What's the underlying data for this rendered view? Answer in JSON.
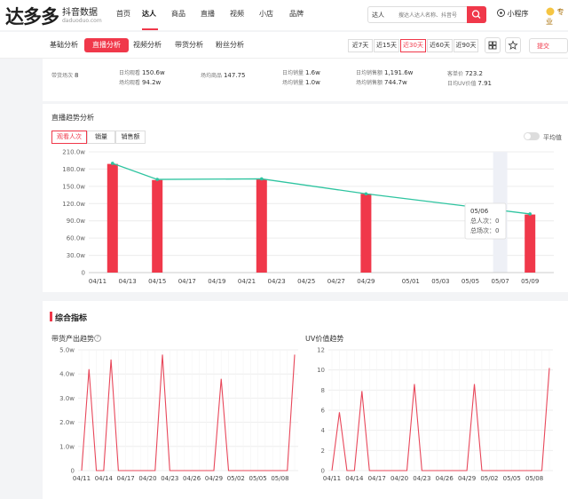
{
  "logo": {
    "name": "达多多",
    "sub": "抖音数据",
    "url": "daduoduo.com"
  },
  "nav": [
    "首页",
    "达人",
    "商品",
    "直播",
    "视频",
    "小店",
    "品牌"
  ],
  "search": {
    "type": "达人",
    "placeholder": "搜达人达人名称、抖音号"
  },
  "mini_program": "小程序",
  "pro": "专业",
  "tabs": [
    "基础分析",
    "直播分析",
    "视频分析",
    "带货分析",
    "粉丝分析"
  ],
  "active_tab": "直播分析",
  "ranges": [
    "近7天",
    "近15天",
    "近30天",
    "近60天",
    "近90天"
  ],
  "selected_range": "近30天",
  "sample": "提交",
  "stats": {
    "c1_label": "带货场次",
    "c1_value": "8",
    "c2_l1": "日均观看",
    "c2_v1": "150.6w",
    "c2_l2": "场均观看",
    "c2_v2": "94.2w",
    "c3_l1": "场均商品",
    "c3_v1": "147.75",
    "c4_l1": "日均销量",
    "c4_v1": "1.6w",
    "c4_l2": "场均销量",
    "c4_v2": "1.0w",
    "c5_l1": "日均销售额",
    "c5_v1": "1,191.6w",
    "c5_l2": "场均销售额",
    "c5_v2": "744.7w",
    "c6_l1": "客单价",
    "c6_v1": "723.2",
    "c6_l2": "日均UV价值",
    "c6_v2": "7.91"
  },
  "trend": {
    "title": "直播趋势分析",
    "segments": [
      "观看人次",
      "销量",
      "销售额"
    ],
    "toggle_label": "平均值",
    "tooltip": {
      "date": "05/06",
      "l1": "总人次",
      "v1": "0",
      "l2": "总场次",
      "v2": "0"
    }
  },
  "composite": {
    "title": "综合指标",
    "left_title": "带货产出趋势",
    "right_title": "UV价值趋势"
  },
  "colors": {
    "accent": "#f0384a",
    "line": "#2ec4a0"
  },
  "chart_data": [
    {
      "type": "bar",
      "ylim": [
        0,
        2100000
      ],
      "yticks": [
        "0",
        "30.0w",
        "60.0w",
        "90.0w",
        "120.0w",
        "150.0w",
        "180.0w",
        "210.0w"
      ],
      "xticks": [
        "04/11",
        "04/13",
        "04/15",
        "04/17",
        "04/19",
        "04/21",
        "04/23",
        "04/25",
        "04/27",
        "04/29",
        "05/01",
        "05/03",
        "05/05",
        "05/07",
        "05/09"
      ],
      "bars": [
        {
          "date": "04/12",
          "value": 1890000
        },
        {
          "date": "04/15",
          "value": 1610000
        },
        {
          "date": "04/22",
          "value": 1620000
        },
        {
          "date": "04/29",
          "value": 1370000
        },
        {
          "date": "05/09",
          "value": 1010000
        }
      ],
      "line": [
        1900000,
        1620000,
        1630000,
        1370000,
        1020000
      ]
    },
    {
      "type": "line",
      "ylim": [
        0,
        50000
      ],
      "yticks": [
        "0",
        "1.0w",
        "2.0w",
        "3.0w",
        "4.0w",
        "5.0w"
      ],
      "xticks": [
        "04/11",
        "04/14",
        "04/17",
        "04/20",
        "04/23",
        "04/26",
        "04/29",
        "05/02",
        "05/05",
        "05/08"
      ],
      "values": [
        0,
        42000,
        0,
        0,
        46000,
        0,
        0,
        0,
        0,
        0,
        0,
        48000,
        0,
        0,
        0,
        0,
        0,
        0,
        0,
        38000,
        0,
        0,
        0,
        0,
        0,
        0,
        0,
        0,
        0,
        48000
      ]
    },
    {
      "type": "line",
      "ylim": [
        0,
        12
      ],
      "yticks": [
        "0",
        "2",
        "4",
        "6",
        "8",
        "10",
        "12"
      ],
      "xticks": [
        "04/11",
        "04/14",
        "04/17",
        "04/20",
        "04/23",
        "04/26",
        "04/29",
        "05/02",
        "05/05",
        "05/08"
      ],
      "values": [
        0,
        5.8,
        0,
        0,
        7.9,
        0,
        0,
        0,
        0,
        0,
        0,
        8.6,
        0,
        0,
        0,
        0,
        0,
        0,
        0,
        8.6,
        0,
        0,
        0,
        0,
        0,
        0,
        0,
        0,
        0,
        10.2
      ]
    }
  ]
}
